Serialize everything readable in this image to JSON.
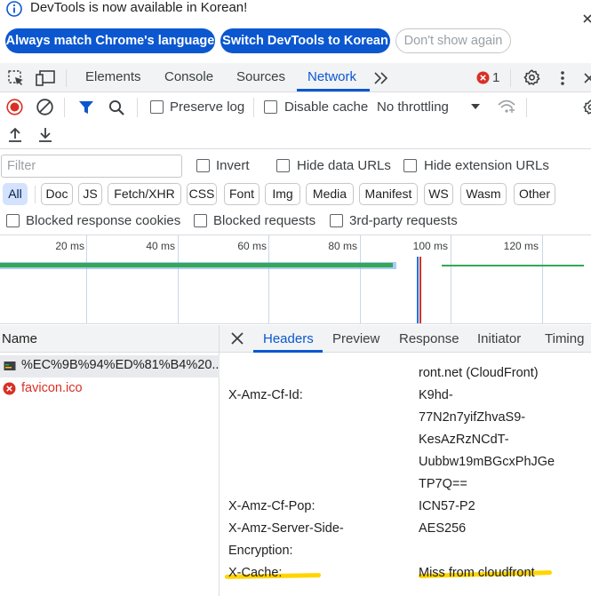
{
  "infobar": {
    "message": "DevTools is now available in Korean!",
    "btn_match": "Always match Chrome's language",
    "btn_switch": "Switch DevTools to Korean",
    "btn_dismiss": "Don't show again"
  },
  "toolbar": {
    "tabs": [
      "Elements",
      "Console",
      "Sources",
      "Network"
    ],
    "active_tab": "Network",
    "error_count": "1"
  },
  "network": {
    "preserve_log": "Preserve log",
    "disable_cache": "Disable cache",
    "throttling": "No throttling"
  },
  "filter": {
    "placeholder": "Filter",
    "invert": "Invert",
    "hide_data_urls": "Hide data URLs",
    "hide_extension_urls": "Hide extension URLs",
    "types": [
      "All",
      "Doc",
      "JS",
      "Fetch/XHR",
      "CSS",
      "Font",
      "Img",
      "Media",
      "Manifest",
      "WS",
      "Wasm",
      "Other"
    ],
    "active_type": "All",
    "blocked_cookies": "Blocked response cookies",
    "blocked_requests": "Blocked requests",
    "third_party": "3rd-party requests"
  },
  "overview": {
    "ticks": [
      "20 ms",
      "40 ms",
      "60 ms",
      "80 ms",
      "100 ms",
      "120 ms"
    ]
  },
  "requests": {
    "column": "Name",
    "rows": [
      {
        "name": "%EC%9B%94%ED%81%B4%20...",
        "status": "ok"
      },
      {
        "name": "favicon.ico",
        "status": "error"
      }
    ]
  },
  "details": {
    "tabs": [
      "Headers",
      "Preview",
      "Response",
      "Initiator",
      "Timing"
    ],
    "active_tab": "Headers",
    "partial_top": "",
    "headers": [
      {
        "key": "",
        "value_lines": [
          "ront.net (CloudFront)"
        ]
      },
      {
        "key": "X-Amz-Cf-Id:",
        "value_lines": [
          "K9hd-",
          "77N2n7yifZhvaS9-",
          "KesAzRzNCdT-",
          "Uubbw19mBGcxPhJGe",
          "TP7Q=="
        ]
      },
      {
        "key": "X-Amz-Cf-Pop:",
        "value_lines": [
          "ICN57-P2"
        ]
      },
      {
        "key_lines": [
          "X-Amz-Server-Side-",
          "Encryption:"
        ],
        "value_lines": [
          "AES256"
        ]
      },
      {
        "key": "X-Cache:",
        "value_lines": [
          "Miss from cloudfront"
        ],
        "highlighted": true
      }
    ]
  },
  "colors": {
    "accent": "#0b57d0",
    "error": "#d93025",
    "highlight": "#ffd500",
    "timeline_bar": "#34a853"
  }
}
